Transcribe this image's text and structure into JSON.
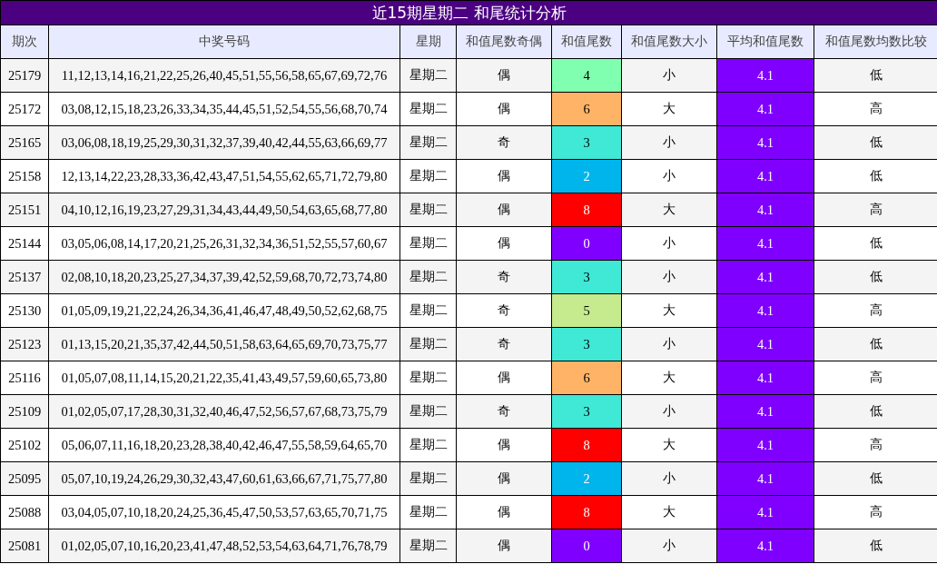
{
  "title": "近15期星期二 和尾统计分析",
  "columns": [
    "期次",
    "中奖号码",
    "星期",
    "和值尾数奇偶",
    "和值尾数",
    "和值尾数大小",
    "平均和值尾数",
    "和值尾数均数比较"
  ],
  "rows": [
    {
      "period": "25179",
      "numbers": "11,12,13,14,16,21,22,25,26,40,45,51,55,56,58,65,67,69,72,76",
      "weekday": "星期二",
      "parity": "偶",
      "tail": "4",
      "color": "#80ffb0",
      "size": "小",
      "average": "4.1",
      "compare": "低"
    },
    {
      "period": "25172",
      "numbers": "03,08,12,15,18,23,26,33,34,35,44,45,51,52,54,55,56,68,70,74",
      "weekday": "星期二",
      "parity": "偶",
      "tail": "6",
      "color": "#ffb366",
      "size": "大",
      "average": "4.1",
      "compare": "高"
    },
    {
      "period": "25165",
      "numbers": "03,06,08,18,19,25,29,30,31,32,37,39,40,42,44,55,63,66,69,77",
      "weekday": "星期二",
      "parity": "奇",
      "tail": "3",
      "color": "#40e8d6",
      "size": "小",
      "average": "4.1",
      "compare": "低"
    },
    {
      "period": "25158",
      "numbers": "12,13,14,22,23,28,33,36,42,43,47,51,54,55,62,65,71,72,79,80",
      "weekday": "星期二",
      "parity": "偶",
      "tail": "2",
      "color": "#00b4ec",
      "size": "小",
      "average": "4.1",
      "compare": "低"
    },
    {
      "period": "25151",
      "numbers": "04,10,12,16,19,23,27,29,31,34,43,44,49,50,54,63,65,68,77,80",
      "weekday": "星期二",
      "parity": "偶",
      "tail": "8",
      "color": "#ff0000",
      "size": "大",
      "average": "4.1",
      "compare": "高"
    },
    {
      "period": "25144",
      "numbers": "03,05,06,08,14,17,20,21,25,26,31,32,34,36,51,52,55,57,60,67",
      "weekday": "星期二",
      "parity": "偶",
      "tail": "0",
      "color": "#8000ff",
      "size": "小",
      "average": "4.1",
      "compare": "低"
    },
    {
      "period": "25137",
      "numbers": "02,08,10,18,20,23,25,27,34,37,39,42,52,59,68,70,72,73,74,80",
      "weekday": "星期二",
      "parity": "奇",
      "tail": "3",
      "color": "#40e8d6",
      "size": "小",
      "average": "4.1",
      "compare": "低"
    },
    {
      "period": "25130",
      "numbers": "01,05,09,19,21,22,24,26,34,36,41,46,47,48,49,50,52,62,68,75",
      "weekday": "星期二",
      "parity": "奇",
      "tail": "5",
      "color": "#c6ea8e",
      "size": "大",
      "average": "4.1",
      "compare": "高"
    },
    {
      "period": "25123",
      "numbers": "01,13,15,20,21,35,37,42,44,50,51,58,63,64,65,69,70,73,75,77",
      "weekday": "星期二",
      "parity": "奇",
      "tail": "3",
      "color": "#40e8d6",
      "size": "小",
      "average": "4.1",
      "compare": "低"
    },
    {
      "period": "25116",
      "numbers": "01,05,07,08,11,14,15,20,21,22,35,41,43,49,57,59,60,65,73,80",
      "weekday": "星期二",
      "parity": "偶",
      "tail": "6",
      "color": "#ffb366",
      "size": "大",
      "average": "4.1",
      "compare": "高"
    },
    {
      "period": "25109",
      "numbers": "01,02,05,07,17,28,30,31,32,40,46,47,52,56,57,67,68,73,75,79",
      "weekday": "星期二",
      "parity": "奇",
      "tail": "3",
      "color": "#40e8d6",
      "size": "小",
      "average": "4.1",
      "compare": "低"
    },
    {
      "period": "25102",
      "numbers": "05,06,07,11,16,18,20,23,28,38,40,42,46,47,55,58,59,64,65,70",
      "weekday": "星期二",
      "parity": "偶",
      "tail": "8",
      "color": "#ff0000",
      "size": "大",
      "average": "4.1",
      "compare": "高"
    },
    {
      "period": "25095",
      "numbers": "05,07,10,19,24,26,29,30,32,43,47,60,61,63,66,67,71,75,77,80",
      "weekday": "星期二",
      "parity": "偶",
      "tail": "2",
      "color": "#00b4ec",
      "size": "小",
      "average": "4.1",
      "compare": "低"
    },
    {
      "period": "25088",
      "numbers": "03,04,05,07,10,18,20,24,25,36,45,47,50,53,57,63,65,70,71,75",
      "weekday": "星期二",
      "parity": "偶",
      "tail": "8",
      "color": "#ff0000",
      "size": "大",
      "average": "4.1",
      "compare": "高"
    },
    {
      "period": "25081",
      "numbers": "01,02,05,07,10,16,20,23,41,47,48,52,53,54,63,64,71,76,78,79",
      "weekday": "星期二",
      "parity": "偶",
      "tail": "0",
      "color": "#8000ff",
      "size": "小",
      "average": "4.1",
      "compare": "低"
    }
  ]
}
